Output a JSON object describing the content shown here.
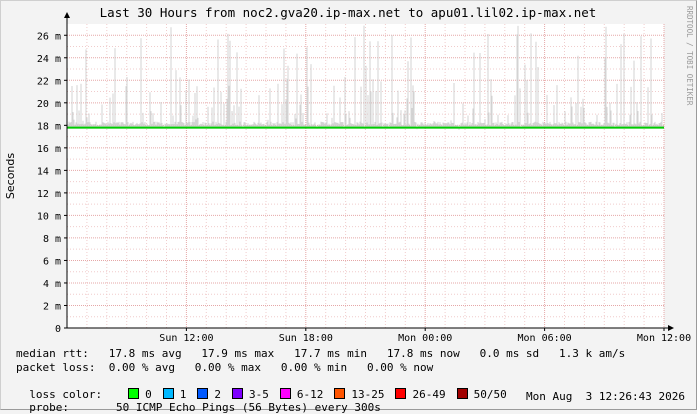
{
  "chart_data": {
    "type": "line",
    "title": "Last 30 Hours from noc2.gva20.ip-max.net to apu01.lil02.ip-max.net",
    "ylabel": "Seconds",
    "ylim": [
      0,
      0.027
    ],
    "yticks": [
      {
        "value": 0,
        "label": "0"
      },
      {
        "value": 0.002,
        "label": "2 m"
      },
      {
        "value": 0.004,
        "label": "4 m"
      },
      {
        "value": 0.006,
        "label": "6 m"
      },
      {
        "value": 0.008,
        "label": "8 m"
      },
      {
        "value": 0.01,
        "label": "10 m"
      },
      {
        "value": 0.012,
        "label": "12 m"
      },
      {
        "value": 0.014,
        "label": "14 m"
      },
      {
        "value": 0.016,
        "label": "16 m"
      },
      {
        "value": 0.018,
        "label": "18 m"
      },
      {
        "value": 0.02,
        "label": "20 m"
      },
      {
        "value": 0.022,
        "label": "22 m"
      },
      {
        "value": 0.024,
        "label": "24 m"
      },
      {
        "value": 0.026,
        "label": "26 m"
      }
    ],
    "xlim_hours": [
      -30,
      0
    ],
    "xticks": [
      {
        "hours_before_end": 24,
        "label": "Sun 12:00"
      },
      {
        "hours_before_end": 18,
        "label": "Sun 18:00"
      },
      {
        "hours_before_end": 12,
        "label": "Mon 00:00"
      },
      {
        "hours_before_end": 6,
        "label": "Mon 06:00"
      },
      {
        "hours_before_end": 0,
        "label": "Mon 12:00"
      }
    ],
    "series": [
      {
        "name": "median rtt",
        "color": "#00cc00",
        "value": 0.0178
      }
    ],
    "smoke": {
      "min": 0.0176,
      "max": 0.027,
      "color": "#cccccc"
    },
    "grid": true,
    "watermark": "RRDTOOL / TOBI OETIKER"
  },
  "legend": {
    "median_rtt": "median rtt:   17.8 ms avg   17.9 ms max   17.7 ms min   17.8 ms now   0.0 ms sd   1.3 k am/s",
    "packet_loss": "packet loss:  0.00 % avg   0.00 % max   0.00 % min   0.00 % now",
    "loss_color_label": "loss color:",
    "loss_colors": [
      {
        "label": "0",
        "color": "#00ff00"
      },
      {
        "label": "1",
        "color": "#00b8ff"
      },
      {
        "label": "2",
        "color": "#0059ff"
      },
      {
        "label": "3-5",
        "color": "#7e00ff"
      },
      {
        "label": "6-12",
        "color": "#ff00ff"
      },
      {
        "label": "13-25",
        "color": "#ff5500"
      },
      {
        "label": "26-49",
        "color": "#ff0000"
      },
      {
        "label": "50/50",
        "color": "#a10000"
      }
    ],
    "probe_label": "probe:",
    "probe_desc": "50 ICMP Echo Pings (56 Bytes) every 300s",
    "timestamp": "Mon Aug  3 12:26:43 2026"
  }
}
